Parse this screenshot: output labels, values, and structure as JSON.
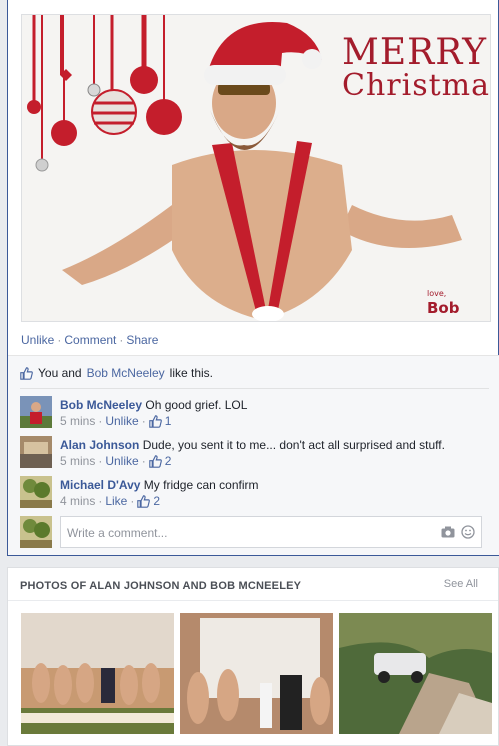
{
  "post": {
    "image_text": {
      "merry": "MERRY",
      "christmas": "Christmas",
      "signature_love": "love,",
      "signature_name": "Bob"
    },
    "actions": [
      "Unlike",
      "Comment",
      "Share"
    ]
  },
  "likes": {
    "you_and": "You and",
    "liker": "Bob McNeeley",
    "suffix": "like this."
  },
  "comments": [
    {
      "author": "Bob McNeeley",
      "text": "Oh good grief. LOL",
      "time": "5 mins",
      "action": "Unlike",
      "likes": "1"
    },
    {
      "author": "Alan Johnson",
      "text": "Dude, you sent it to me... don't act all surprised and stuff.",
      "time": "5 mins",
      "action": "Unlike",
      "likes": "2"
    },
    {
      "author": "Michael D'Avy",
      "text": "My fridge can confirm",
      "time": "4 mins",
      "action": "Like",
      "likes": "2"
    }
  ],
  "composer": {
    "placeholder": "Write a comment..."
  },
  "photos": {
    "title": "PHOTOS OF ALAN JOHNSON AND BOB MCNEELEY",
    "see_all": "See All"
  },
  "colors": {
    "link": "#4b67a1",
    "author": "#3b5998",
    "merry_red": "#a31c2c"
  }
}
